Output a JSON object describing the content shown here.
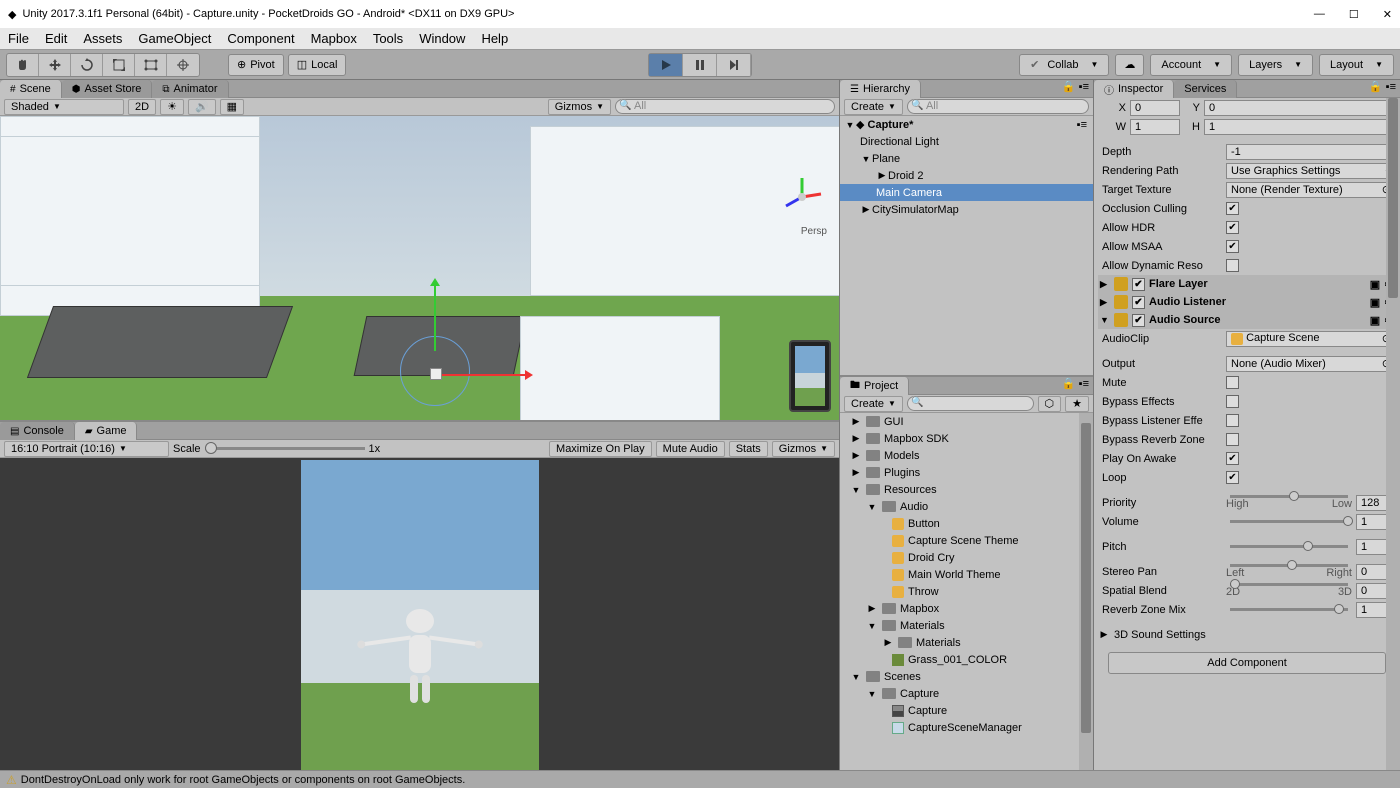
{
  "title": "Unity 2017.3.1f1 Personal (64bit) - Capture.unity - PocketDroids GO - Android* <DX11 on DX9 GPU>",
  "menu": [
    "File",
    "Edit",
    "Assets",
    "GameObject",
    "Component",
    "Mapbox",
    "Tools",
    "Window",
    "Help"
  ],
  "toolbar": {
    "pivot": "Pivot",
    "local": "Local",
    "collab": "Collab",
    "account": "Account",
    "layers": "Layers",
    "layout": "Layout"
  },
  "sceneTabs": {
    "scene": "Scene",
    "assetStore": "Asset Store",
    "animator": "Animator"
  },
  "sceneToolbar": {
    "shaded": "Shaded",
    "mode2d": "2D",
    "gizmos": "Gizmos",
    "searchPlaceholder": "All",
    "persp": "Persp"
  },
  "consoleTabs": {
    "console": "Console",
    "game": "Game"
  },
  "gameToolbar": {
    "aspect": "16:10 Portrait (10:16)",
    "scale": "Scale",
    "scaleVal": "1x",
    "maximize": "Maximize On Play",
    "mute": "Mute Audio",
    "stats": "Stats",
    "gizmos": "Gizmos"
  },
  "hierarchy": {
    "title": "Hierarchy",
    "create": "Create",
    "searchPlaceholder": "All",
    "root": "Capture*",
    "items": [
      "Directional Light",
      "Plane",
      "Droid 2",
      "Main Camera",
      "CitySimulatorMap"
    ]
  },
  "project": {
    "title": "Project",
    "create": "Create",
    "items": {
      "gui": "GUI",
      "mapboxSdk": "Mapbox SDK",
      "models": "Models",
      "plugins": "Plugins",
      "resources": "Resources",
      "audio": "Audio",
      "button": "Button",
      "captureTheme": "Capture Scene Theme",
      "droidCry": "Droid Cry",
      "mainWorldTheme": "Main World Theme",
      "throw": "Throw",
      "mapbox": "Mapbox",
      "materials": "Materials",
      "materials2": "Materials",
      "grass": "Grass_001_COLOR",
      "scenes": "Scenes",
      "capture": "Capture",
      "captureScene": "Capture",
      "captureMgr": "CaptureSceneManager"
    }
  },
  "inspector": {
    "tab": "Inspector",
    "services": "Services",
    "xLabel": "X",
    "xVal": "0",
    "yLabel": "Y",
    "yVal": "0",
    "wLabel": "W",
    "wVal": "1",
    "hLabel": "H",
    "hVal": "1",
    "depth": "Depth",
    "depthVal": "-1",
    "renderingPath": "Rendering Path",
    "renderingPathVal": "Use Graphics Settings",
    "targetTexture": "Target Texture",
    "targetTextureVal": "None (Render Texture)",
    "occlusion": "Occlusion Culling",
    "allowHdr": "Allow HDR",
    "allowMsaa": "Allow MSAA",
    "allowDyn": "Allow Dynamic Reso",
    "flare": "Flare Layer",
    "audioListener": "Audio Listener",
    "audioSource": "Audio Source",
    "audioClip": "AudioClip",
    "audioClipVal": "Capture Scene",
    "output": "Output",
    "outputVal": "None (Audio Mixer)",
    "mute": "Mute",
    "bypassFx": "Bypass Effects",
    "bypassListener": "Bypass Listener Effe",
    "bypassReverb": "Bypass Reverb Zone",
    "playOnAwake": "Play On Awake",
    "loop": "Loop",
    "priority": "Priority",
    "priorityVal": "128",
    "priorityLow": "High",
    "priorityHigh": "Low",
    "volume": "Volume",
    "volumeVal": "1",
    "pitch": "Pitch",
    "pitchVal": "1",
    "stereoPan": "Stereo Pan",
    "stereoPanVal": "0",
    "panL": "Left",
    "panR": "Right",
    "spatialBlend": "Spatial Blend",
    "spatialBlendVal": "0",
    "sb2d": "2D",
    "sb3d": "3D",
    "reverbMix": "Reverb Zone Mix",
    "reverbMixVal": "1",
    "sound3d": "3D Sound Settings",
    "addComponent": "Add Component"
  },
  "status": "DontDestroyOnLoad only work for root GameObjects or components on root GameObjects."
}
